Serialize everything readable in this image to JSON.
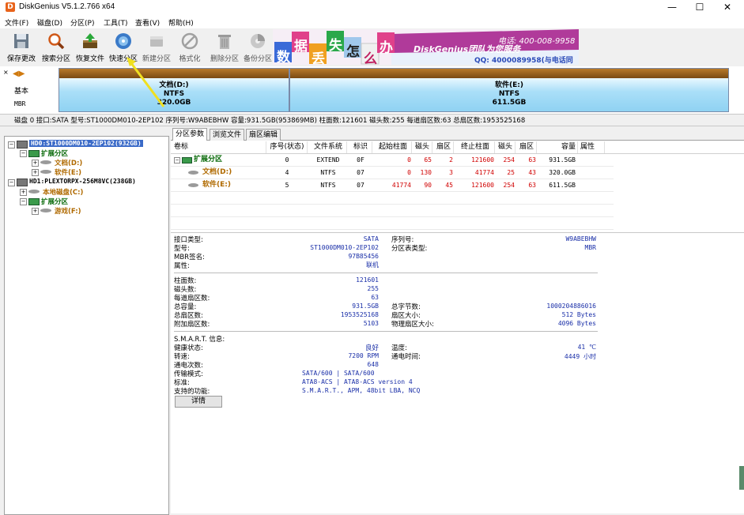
{
  "window": {
    "title": "DiskGenius V5.1.2.766 x64",
    "icon_letter": "D",
    "min": "—",
    "max": "☐",
    "close": "✕"
  },
  "menu": [
    "文件(F)",
    "磁盘(D)",
    "分区(P)",
    "工具(T)",
    "查看(V)",
    "帮助(H)"
  ],
  "toolbar": [
    {
      "label": "保存更改",
      "icon": "save-icon"
    },
    {
      "label": "搜索分区",
      "icon": "search-icon"
    },
    {
      "label": "恢复文件",
      "icon": "recover-icon"
    },
    {
      "label": "快速分区",
      "icon": "quick-partition-icon"
    },
    {
      "label": "新建分区",
      "icon": "new-partition-icon"
    },
    {
      "label": "格式化",
      "icon": "format-icon"
    },
    {
      "label": "删除分区",
      "icon": "delete-icon"
    },
    {
      "label": "备份分区",
      "icon": "backup-icon"
    }
  ],
  "banner": {
    "chars": [
      "数",
      "据",
      "丢",
      "失",
      "怎",
      "么",
      "办"
    ],
    "line1": "DiskGenius团队为您服务",
    "phone": "电话: 400-008-9958",
    "qq": "QQ: 4000089958(与电话同号)",
    "colors": {
      "purple": "#9a3aa8",
      "blue": "#2a6ad8",
      "pink": "#e0408a",
      "green": "#2aa84a"
    }
  },
  "diskmap": {
    "nav": "◀▶",
    "type": "基本",
    "table": "MBR",
    "partitions": [
      {
        "name": "文档(D:)",
        "fs": "NTFS",
        "size": "320.0GB"
      },
      {
        "name": "软件(E:)",
        "fs": "NTFS",
        "size": "611.5GB"
      }
    ]
  },
  "diskinfo": "磁盘 0 接口:SATA  型号:ST1000DM010-2EP102  序列号:W9ABEBHW  容量:931.5GB(953869MB)  柱面数:121601  磁头数:255  每道扇区数:63  总扇区数:1953525168",
  "tree": [
    {
      "label": "HD0:ST1000DM010-2EP102(932GB)",
      "level": 0,
      "type": "disk",
      "selected": true
    },
    {
      "label": "扩展分区",
      "level": 1,
      "type": "ext"
    },
    {
      "label": "文档(D:)",
      "level": 2,
      "type": "vol"
    },
    {
      "label": "软件(E:)",
      "level": 2,
      "type": "vol"
    },
    {
      "label": "HD1:PLEXTORPX-256M8VC(238GB)",
      "level": 0,
      "type": "disk"
    },
    {
      "label": "本地磁盘(C:)",
      "level": 1,
      "type": "vol"
    },
    {
      "label": "扩展分区",
      "level": 1,
      "type": "ext"
    },
    {
      "label": "游戏(F:)",
      "level": 2,
      "type": "vol"
    }
  ],
  "tabs": [
    "分区参数",
    "浏览文件",
    "扇区编辑"
  ],
  "partition_table": {
    "headers": [
      "卷标",
      "序号(状态)",
      "文件系统",
      "标识",
      "起始柱面",
      "磁头",
      "扇区",
      "终止柱面",
      "磁头",
      "扇区",
      "容量",
      "属性"
    ],
    "rows": [
      {
        "label": "扩展分区",
        "no": "0",
        "fs": "EXTEND",
        "id": "0F",
        "sc": "0",
        "sh": "65",
        "ss": "2",
        "ec": "121600",
        "eh": "254",
        "es": "63",
        "cap": "931.5GB",
        "attr": ""
      },
      {
        "label": "文档(D:)",
        "no": "4",
        "fs": "NTFS",
        "id": "07",
        "sc": "0",
        "sh": "130",
        "ss": "3",
        "ec": "41774",
        "eh": "25",
        "es": "43",
        "cap": "320.0GB",
        "attr": ""
      },
      {
        "label": "软件(E:)",
        "no": "5",
        "fs": "NTFS",
        "id": "07",
        "sc": "41774",
        "sh": "90",
        "ss": "45",
        "ec": "121600",
        "eh": "254",
        "es": "63",
        "cap": "611.5GB",
        "attr": ""
      }
    ]
  },
  "details": {
    "interface_label": "接口类型:",
    "interface": "SATA",
    "serial_label": "序列号:",
    "serial": "W9ABEBHW",
    "model_label": "型号:",
    "model": "ST1000DM010-2EP102",
    "ptype_label": "分区表类型:",
    "ptype": "MBR",
    "mbr_sig_label": "MBR签名:",
    "mbr_sig": "97B85456",
    "attr_label": "属性:",
    "attr": "联机",
    "cyl_label": "柱面数:",
    "cyl": "121601",
    "heads_label": "磁头数:",
    "heads": "255",
    "spt_label": "每道扇区数:",
    "spt": "63",
    "cap_label": "总容量:",
    "cap": "931.5GB",
    "bytes_label": "总字节数:",
    "bytes": "1000204886016",
    "sectors_label": "总扇区数:",
    "sectors": "1953525168",
    "secsize_label": "扇区大小:",
    "secsize": "512 Bytes",
    "extra_label": "附加扇区数:",
    "extra": "5103",
    "physsec_label": "物理扇区大小:",
    "physsec": "4096 Bytes",
    "smart_label": "S.M.A.R.T. 信息:",
    "health_label": "健康状态:",
    "health": "良好",
    "temp_label": "温度:",
    "temp": "41 ℃",
    "rpm_label": "转速:",
    "rpm": "7200 RPM",
    "pot_label": "通电时间:",
    "pot": "4449 小时",
    "poc_label": "通电次数:",
    "poc": "648",
    "mode_label": "传输模式:",
    "mode": "SATA/600 | SATA/600",
    "std_label": "标准:",
    "std": "ATA8-ACS | ATA8-ACS version 4",
    "feat_label": "支持的功能:",
    "feat": "S.M.A.R.T., APM, 48bit LBA, NCQ",
    "button": "详情"
  }
}
